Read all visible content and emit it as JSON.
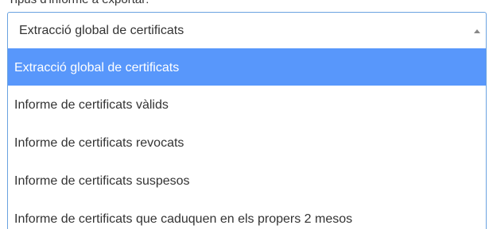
{
  "field": {
    "label": "Tipus d'informe a exportar:",
    "selected_value": "Extracció global de certificats"
  },
  "icons": {
    "caret": "caret-up-icon"
  },
  "colors": {
    "highlight": "#5897fb",
    "border": "#6aa2e0",
    "text": "#333333",
    "highlight_text": "#ffffff"
  },
  "options": [
    {
      "label": "Extracció global de certificats",
      "highlighted": true
    },
    {
      "label": "Informe de certificats vàlids",
      "highlighted": false
    },
    {
      "label": "Informe de certificats revocats",
      "highlighted": false
    },
    {
      "label": "Informe de certificats suspesos",
      "highlighted": false
    },
    {
      "label": "Informe de certificats que caduquen en els propers 2 mesos",
      "highlighted": false
    }
  ]
}
